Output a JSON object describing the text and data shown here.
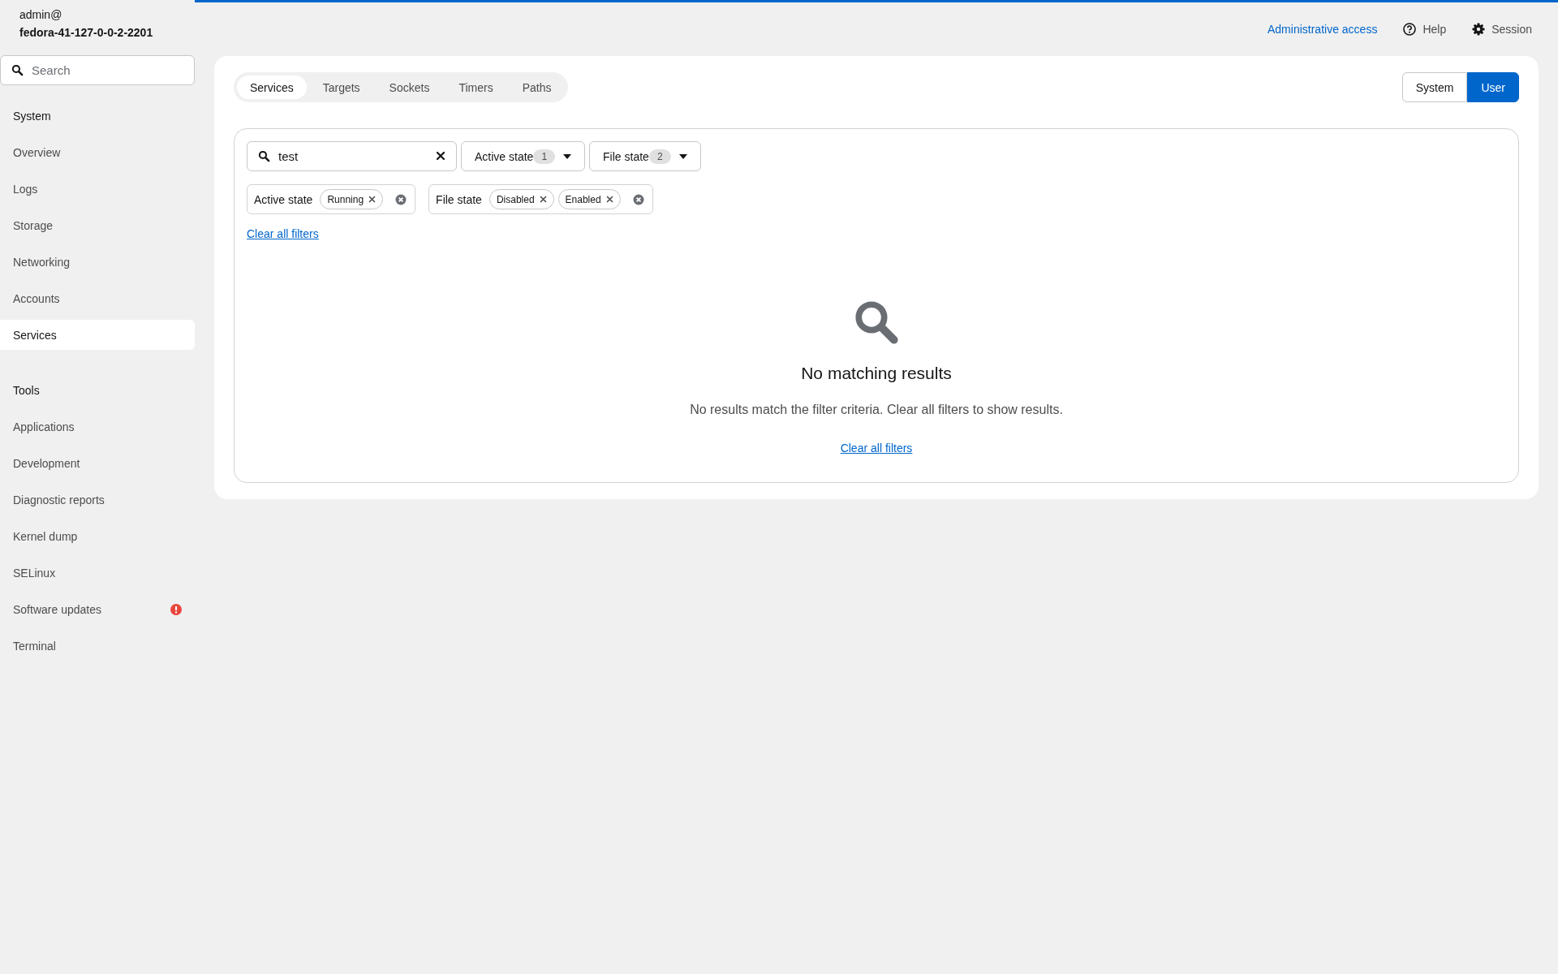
{
  "host": {
    "user": "admin@",
    "name": "fedora-41-127-0-0-2-2201"
  },
  "sidebar": {
    "search": {
      "placeholder": "Search"
    },
    "sections": [
      {
        "heading": "System",
        "items": [
          {
            "label": "Overview",
            "selected": false,
            "alert": false
          },
          {
            "label": "Logs",
            "selected": false,
            "alert": false
          },
          {
            "label": "Storage",
            "selected": false,
            "alert": false
          },
          {
            "label": "Networking",
            "selected": false,
            "alert": false
          },
          {
            "label": "Accounts",
            "selected": false,
            "alert": false
          },
          {
            "label": "Services",
            "selected": true,
            "alert": false
          }
        ]
      },
      {
        "heading": "Tools",
        "items": [
          {
            "label": "Applications",
            "selected": false,
            "alert": false
          },
          {
            "label": "Development",
            "selected": false,
            "alert": false
          },
          {
            "label": "Diagnostic reports",
            "selected": false,
            "alert": false
          },
          {
            "label": "Kernel dump",
            "selected": false,
            "alert": false
          },
          {
            "label": "SELinux",
            "selected": false,
            "alert": false
          },
          {
            "label": "Software updates",
            "selected": false,
            "alert": true
          },
          {
            "label": "Terminal",
            "selected": false,
            "alert": false
          }
        ]
      }
    ]
  },
  "header": {
    "admin_link": "Administrative access",
    "help": "Help",
    "session": "Session"
  },
  "tabs": [
    {
      "label": "Services",
      "selected": true
    },
    {
      "label": "Targets",
      "selected": false
    },
    {
      "label": "Sockets",
      "selected": false
    },
    {
      "label": "Timers",
      "selected": false
    },
    {
      "label": "Paths",
      "selected": false
    }
  ],
  "scope": [
    {
      "label": "System",
      "selected": false
    },
    {
      "label": "User",
      "selected": true
    }
  ],
  "toolbar": {
    "search": {
      "value": "test"
    },
    "dropdowns": [
      {
        "label": "Active state",
        "count": "1"
      },
      {
        "label": "File state",
        "count": "2"
      }
    ],
    "chip_groups": [
      {
        "category": "Active state",
        "chips": [
          "Running"
        ]
      },
      {
        "category": "File state",
        "chips": [
          "Disabled",
          "Enabled"
        ]
      }
    ],
    "clear_link": "Clear all filters"
  },
  "empty_state": {
    "title": "No matching results",
    "body": "No results match the filter criteria. Clear all filters to show results.",
    "link": "Clear all filters"
  }
}
